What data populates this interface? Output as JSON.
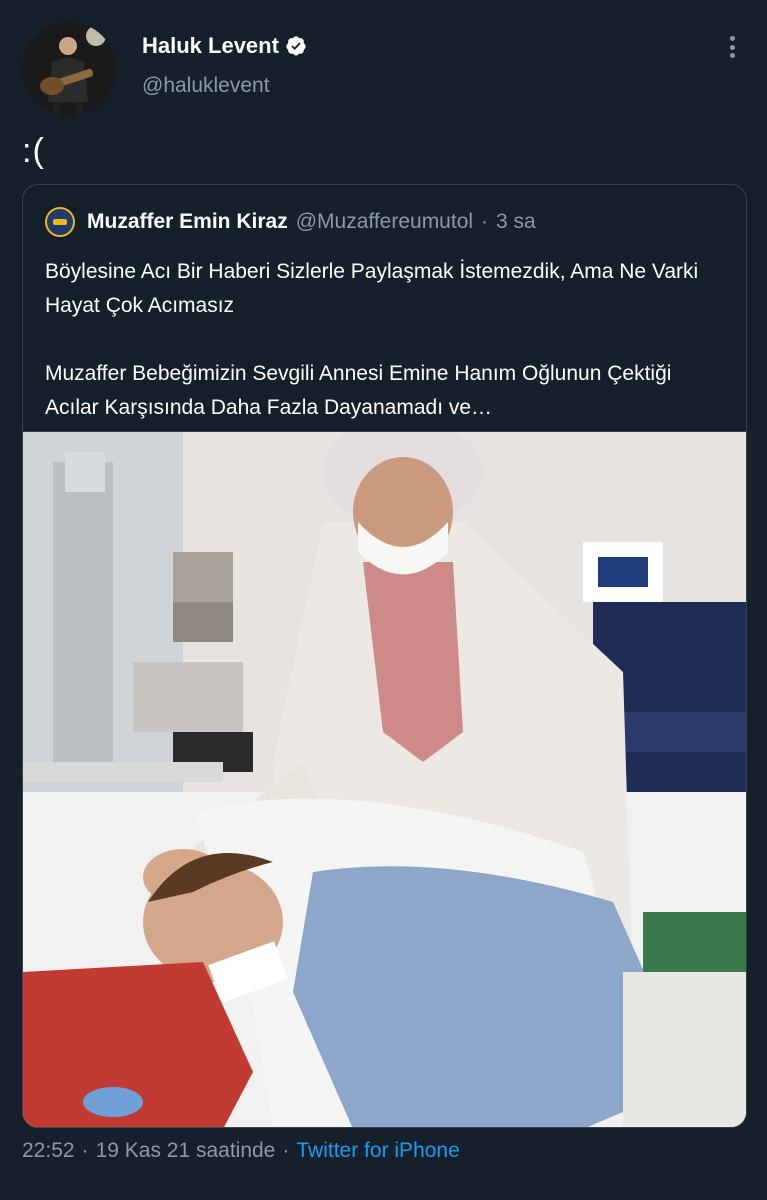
{
  "author": {
    "display_name": "Haluk Levent",
    "handle": "@haluklevent",
    "avatar_icon": "avatar-guitarist",
    "verified_icon": "verified-badge-icon"
  },
  "tweet": {
    "text": ":("
  },
  "quoted": {
    "display_name": "Muzaffer Emin Kiraz",
    "handle": "@Muzaffereumutol",
    "separator": "·",
    "time": "3 sa",
    "paragraph_1": "Böylesine Acı Bir Haberi Sizlerle Paylaşmak İstemezdik, Ama Ne Varki Hayat Çok Acımasız",
    "paragraph_2": "Muzaffer Bebeğimizin Sevgili Annesi Emine Hanım Oğlunun Çektiği Acılar Karşısında Daha Fazla Dayanamadı ve…"
  },
  "meta": {
    "time": "22:52",
    "separator": "·",
    "date": "19 Kas 21 saatinde",
    "source": "Twitter for iPhone"
  },
  "colors": {
    "background": "#15202b",
    "border": "#38444d",
    "secondary_text": "#8b98a5",
    "link": "#1d9bf0",
    "verified": "#ffffff"
  }
}
